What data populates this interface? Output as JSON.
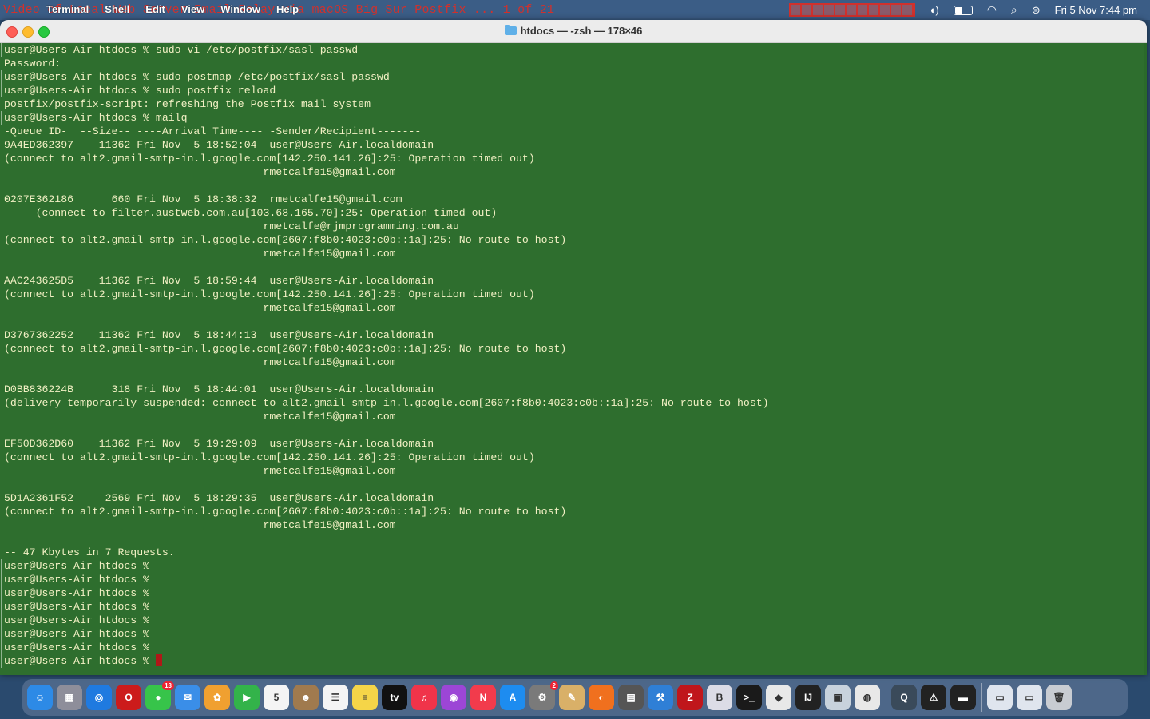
{
  "menubar": {
    "overlay_title": "Video of Local Web Server Email Relay via macOS Big Sur Postfix ... 1 of 21",
    "app_name": "Terminal",
    "menus": [
      "Shell",
      "Edit",
      "View",
      "Window",
      "Help"
    ],
    "datetime": "Fri 5 Nov  7:44 pm"
  },
  "window": {
    "title": "htdocs — -zsh — 178×46"
  },
  "terminal": {
    "lines": [
      {
        "text": "user@Users-Air htdocs % sudo vi /etc/postfix/sasl_passwd",
        "prompt": true
      },
      {
        "text": "Password:",
        "prompt": false
      },
      {
        "text": "user@Users-Air htdocs % sudo postmap /etc/postfix/sasl_passwd",
        "prompt": true
      },
      {
        "text": "user@Users-Air htdocs % sudo postfix reload",
        "prompt": true
      },
      {
        "text": "postfix/postfix-script: refreshing the Postfix mail system",
        "prompt": false
      },
      {
        "text": "user@Users-Air htdocs % mailq",
        "prompt": true
      },
      {
        "text": "-Queue ID-  --Size-- ----Arrival Time---- -Sender/Recipient-------",
        "prompt": false
      },
      {
        "text": "9A4ED362397    11362 Fri Nov  5 18:52:04  user@Users-Air.localdomain",
        "prompt": false
      },
      {
        "text": "(connect to alt2.gmail-smtp-in.l.google.com[142.250.141.26]:25: Operation timed out)",
        "prompt": false
      },
      {
        "text": "                                         rmetcalfe15@gmail.com",
        "prompt": false
      },
      {
        "text": "",
        "prompt": false
      },
      {
        "text": "0207E362186      660 Fri Nov  5 18:38:32  rmetcalfe15@gmail.com",
        "prompt": false
      },
      {
        "text": "     (connect to filter.austweb.com.au[103.68.165.70]:25: Operation timed out)",
        "prompt": false
      },
      {
        "text": "                                         rmetcalfe@rjmprogramming.com.au",
        "prompt": false
      },
      {
        "text": "(connect to alt2.gmail-smtp-in.l.google.com[2607:f8b0:4023:c0b::1a]:25: No route to host)",
        "prompt": false
      },
      {
        "text": "                                         rmetcalfe15@gmail.com",
        "prompt": false
      },
      {
        "text": "",
        "prompt": false
      },
      {
        "text": "AAC243625D5    11362 Fri Nov  5 18:59:44  user@Users-Air.localdomain",
        "prompt": false
      },
      {
        "text": "(connect to alt2.gmail-smtp-in.l.google.com[142.250.141.26]:25: Operation timed out)",
        "prompt": false
      },
      {
        "text": "                                         rmetcalfe15@gmail.com",
        "prompt": false
      },
      {
        "text": "",
        "prompt": false
      },
      {
        "text": "D3767362252    11362 Fri Nov  5 18:44:13  user@Users-Air.localdomain",
        "prompt": false
      },
      {
        "text": "(connect to alt2.gmail-smtp-in.l.google.com[2607:f8b0:4023:c0b::1a]:25: No route to host)",
        "prompt": false
      },
      {
        "text": "                                         rmetcalfe15@gmail.com",
        "prompt": false
      },
      {
        "text": "",
        "prompt": false
      },
      {
        "text": "D0BB836224B      318 Fri Nov  5 18:44:01  user@Users-Air.localdomain",
        "prompt": false
      },
      {
        "text": "(delivery temporarily suspended: connect to alt2.gmail-smtp-in.l.google.com[2607:f8b0:4023:c0b::1a]:25: No route to host)",
        "prompt": false
      },
      {
        "text": "                                         rmetcalfe15@gmail.com",
        "prompt": false
      },
      {
        "text": "",
        "prompt": false
      },
      {
        "text": "EF50D362D60    11362 Fri Nov  5 19:29:09  user@Users-Air.localdomain",
        "prompt": false
      },
      {
        "text": "(connect to alt2.gmail-smtp-in.l.google.com[142.250.141.26]:25: Operation timed out)",
        "prompt": false
      },
      {
        "text": "                                         rmetcalfe15@gmail.com",
        "prompt": false
      },
      {
        "text": "",
        "prompt": false
      },
      {
        "text": "5D1A2361F52     2569 Fri Nov  5 18:29:35  user@Users-Air.localdomain",
        "prompt": false
      },
      {
        "text": "(connect to alt2.gmail-smtp-in.l.google.com[2607:f8b0:4023:c0b::1a]:25: No route to host)",
        "prompt": false
      },
      {
        "text": "                                         rmetcalfe15@gmail.com",
        "prompt": false
      },
      {
        "text": "",
        "prompt": false
      },
      {
        "text": "-- 47 Kbytes in 7 Requests.",
        "prompt": false
      },
      {
        "text": "user@Users-Air htdocs %",
        "prompt": true
      },
      {
        "text": "user@Users-Air htdocs %",
        "prompt": true
      },
      {
        "text": "user@Users-Air htdocs %",
        "prompt": true
      },
      {
        "text": "user@Users-Air htdocs %",
        "prompt": true
      },
      {
        "text": "user@Users-Air htdocs %",
        "prompt": true
      },
      {
        "text": "user@Users-Air htdocs %",
        "prompt": true
      },
      {
        "text": "user@Users-Air htdocs %",
        "prompt": true
      },
      {
        "text": "user@Users-Air htdocs % ",
        "prompt": true,
        "cursor": true
      }
    ]
  },
  "colors": {
    "terminal_bg": "#2e6e2e",
    "terminal_fg": "#f2f0c4",
    "cursor": "#b01818"
  },
  "dock": {
    "items": [
      {
        "name": "finder-icon",
        "color": "#2d8ae6",
        "glyph": "☺"
      },
      {
        "name": "launchpad-icon",
        "color": "#8e8e9a",
        "glyph": "▦"
      },
      {
        "name": "safari-icon",
        "color": "#1f7ae0",
        "glyph": "◎"
      },
      {
        "name": "opera-icon",
        "color": "#cc1b1b",
        "glyph": "O"
      },
      {
        "name": "messages-icon",
        "color": "#37c44a",
        "glyph": "●",
        "badge": "13"
      },
      {
        "name": "mail-icon",
        "color": "#3a8ee8",
        "glyph": "✉"
      },
      {
        "name": "photos-icon",
        "color": "#f0a030",
        "glyph": "✿"
      },
      {
        "name": "facetime-icon",
        "color": "#33b34a",
        "glyph": "▶"
      },
      {
        "name": "calendar-icon",
        "color": "#f4f4f4",
        "glyph": "5"
      },
      {
        "name": "contacts-icon",
        "color": "#a07a4e",
        "glyph": "☻"
      },
      {
        "name": "reminders-icon",
        "color": "#f4f4f4",
        "glyph": "☰"
      },
      {
        "name": "notes-icon",
        "color": "#f5d548",
        "glyph": "≡"
      },
      {
        "name": "apple-tv-icon",
        "color": "#111111",
        "glyph": "tv"
      },
      {
        "name": "music-icon",
        "color": "#f0344a",
        "glyph": "♫"
      },
      {
        "name": "podcasts-icon",
        "color": "#9c46d6",
        "glyph": "◉"
      },
      {
        "name": "news-icon",
        "color": "#f23b4c",
        "glyph": "N"
      },
      {
        "name": "app-store-icon",
        "color": "#1d8cf0",
        "glyph": "A"
      },
      {
        "name": "system-preferences-icon",
        "color": "#7a7a7a",
        "glyph": "⚙",
        "badge": "2"
      },
      {
        "name": "paint-icon",
        "color": "#d9b068",
        "glyph": "✎"
      },
      {
        "name": "firefox-icon",
        "color": "#f0701e",
        "glyph": "◐"
      },
      {
        "name": "calculator-icon",
        "color": "#555555",
        "glyph": "▤"
      },
      {
        "name": "xcode-icon",
        "color": "#2f7fd6",
        "glyph": "⚒"
      },
      {
        "name": "filezilla-icon",
        "color": "#c0161b",
        "glyph": "Z"
      },
      {
        "name": "bbedit-icon",
        "color": "#dcdce6",
        "glyph": "B"
      },
      {
        "name": "terminal-icon",
        "color": "#1a1a1a",
        "glyph": ">_"
      },
      {
        "name": "sequel-icon",
        "color": "#e8e8e8",
        "glyph": "◆"
      },
      {
        "name": "intellij-icon",
        "color": "#222222",
        "glyph": "IJ"
      },
      {
        "name": "preview-icon",
        "color": "#c8d2dc",
        "glyph": "▣"
      },
      {
        "name": "chrome-icon",
        "color": "#e8e8e8",
        "glyph": "◍"
      },
      {
        "name": "quicktime-icon",
        "color": "#3a4a5a",
        "glyph": "Q"
      },
      {
        "name": "console-icon",
        "color": "#222222",
        "glyph": "⚠"
      },
      {
        "name": "screen-recorder-icon",
        "color": "#222222",
        "glyph": "▬"
      },
      {
        "name": "downloads-stack-icon",
        "color": "#dfe5ee",
        "glyph": "▭"
      },
      {
        "name": "documents-stack-icon",
        "color": "#dfe5ee",
        "glyph": "▭"
      },
      {
        "name": "trash-icon",
        "color": "#c8ccd2",
        "glyph": "🗑"
      }
    ]
  }
}
